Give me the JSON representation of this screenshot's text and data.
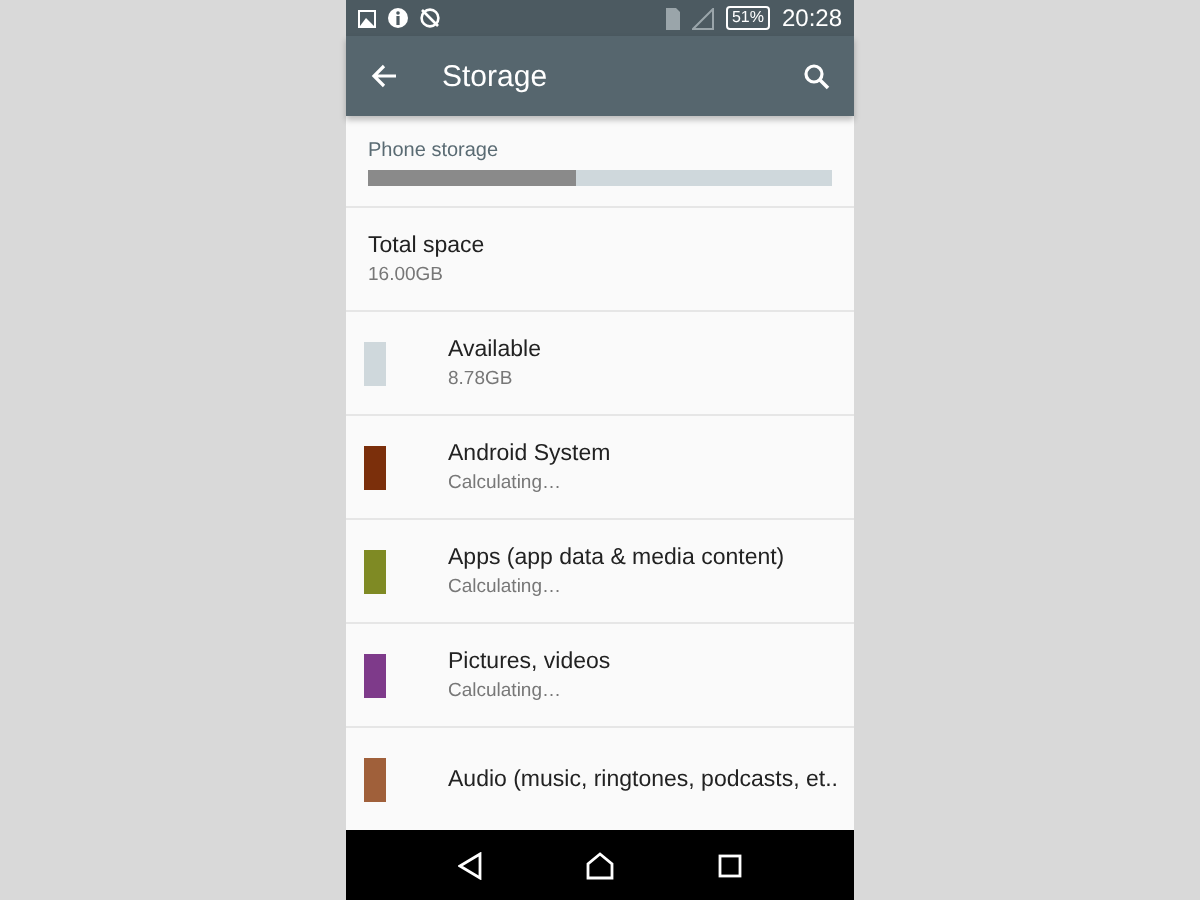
{
  "status_bar": {
    "battery": "51%",
    "time": "20:28"
  },
  "app_bar": {
    "title": "Storage"
  },
  "section": {
    "title": "Phone storage",
    "level": 0.45
  },
  "total": {
    "title": "Total space",
    "value": "16.00GB"
  },
  "categories": [
    {
      "name": "Available",
      "detail": "8.78GB",
      "color": "#cfd8dc"
    },
    {
      "name": "Android System",
      "detail": "Calculating…",
      "color": "#7b2f0b"
    },
    {
      "name": "Apps (app data & media content)",
      "detail": "Calculating…",
      "color": "#7f8a24"
    },
    {
      "name": "Pictures, videos",
      "detail": "Calculating…",
      "color": "#7e3a8a"
    },
    {
      "name": "Audio (music, ringtones, podcasts, et..",
      "color": "#a0603a"
    }
  ]
}
